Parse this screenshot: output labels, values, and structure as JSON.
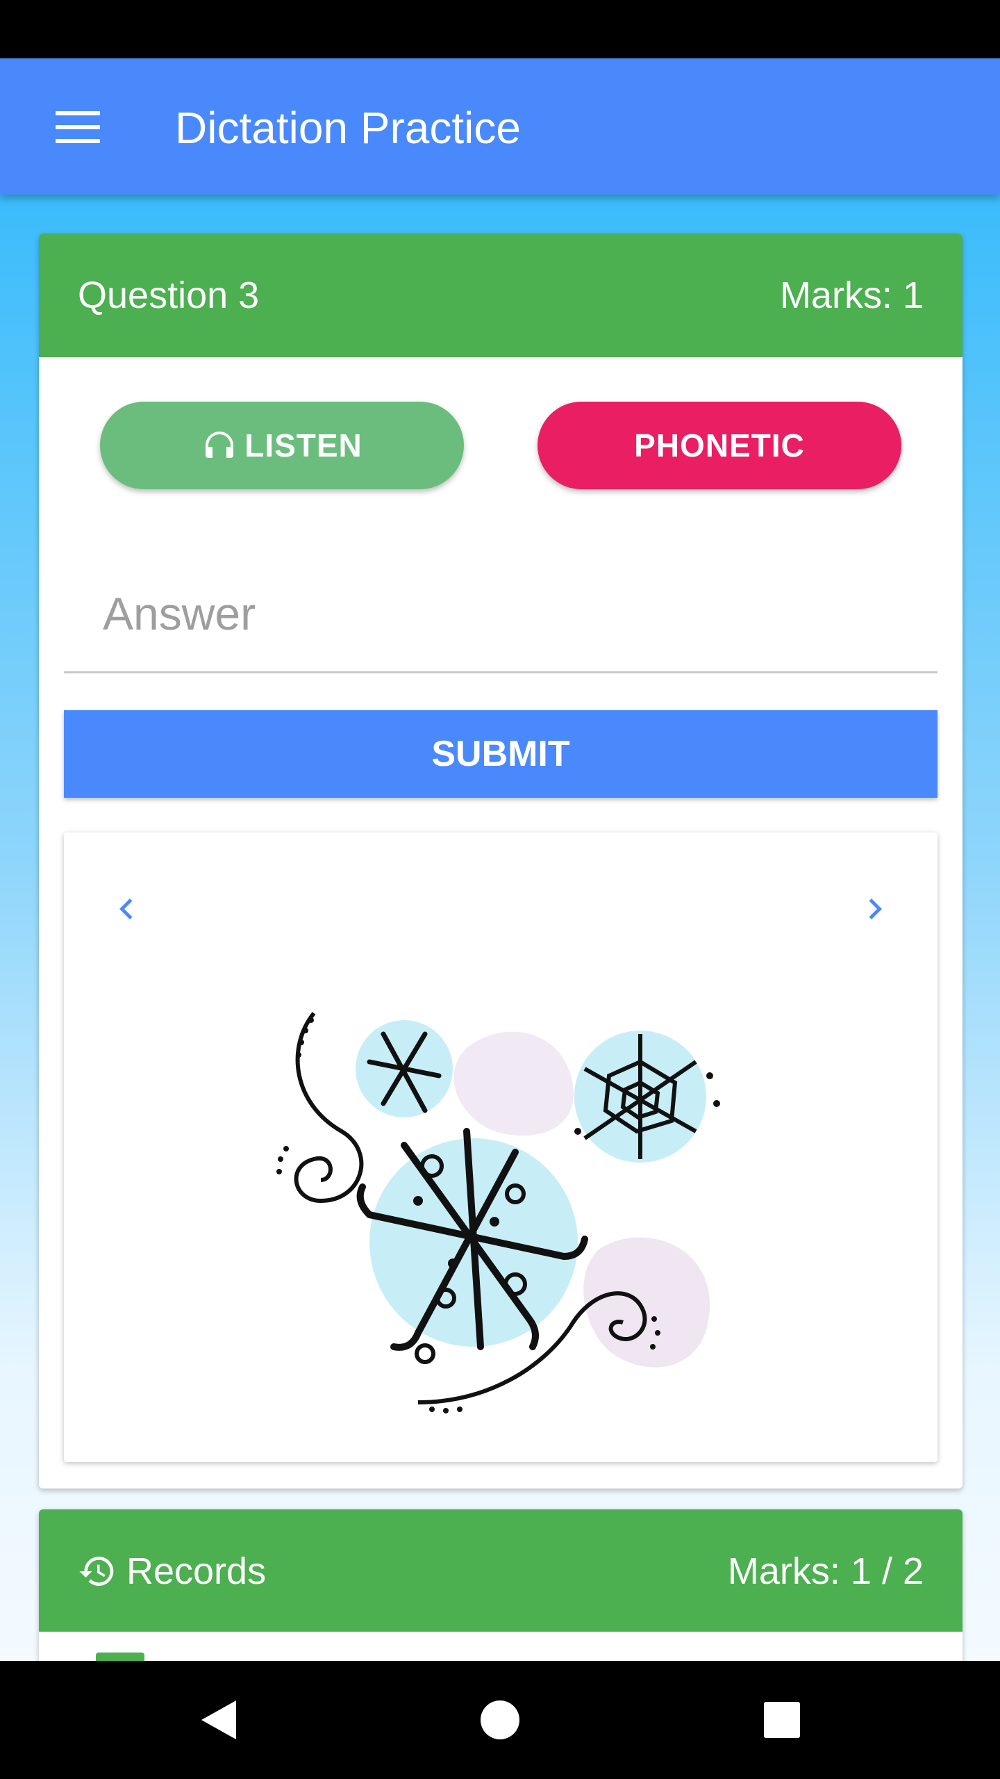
{
  "app_bar": {
    "title": "Dictation Practice",
    "menu_icon": "hamburger-menu-icon"
  },
  "question_card": {
    "title": "Question 3",
    "marks": "Marks: 1",
    "listen_label": "LISTEN",
    "listen_icon": "headphones-icon",
    "phonetic_label": "PHONETIC",
    "answer_placeholder": "Answer",
    "answer_value": "",
    "submit_label": "SUBMIT",
    "carousel": {
      "prev_icon": "chevron-left-icon",
      "next_icon": "chevron-right-icon",
      "image": "snowflakes-illustration"
    }
  },
  "records_card": {
    "title": "Records",
    "icon": "history-icon",
    "marks": "Marks: 1 / 2"
  },
  "colors": {
    "primary": "#4a89fb",
    "green": "#4caf50",
    "listen_green": "#6abd7c",
    "pink": "#e91e63"
  },
  "system_nav": {
    "back_icon": "back-triangle-icon",
    "home_icon": "home-circle-icon",
    "recents_icon": "recents-square-icon"
  }
}
